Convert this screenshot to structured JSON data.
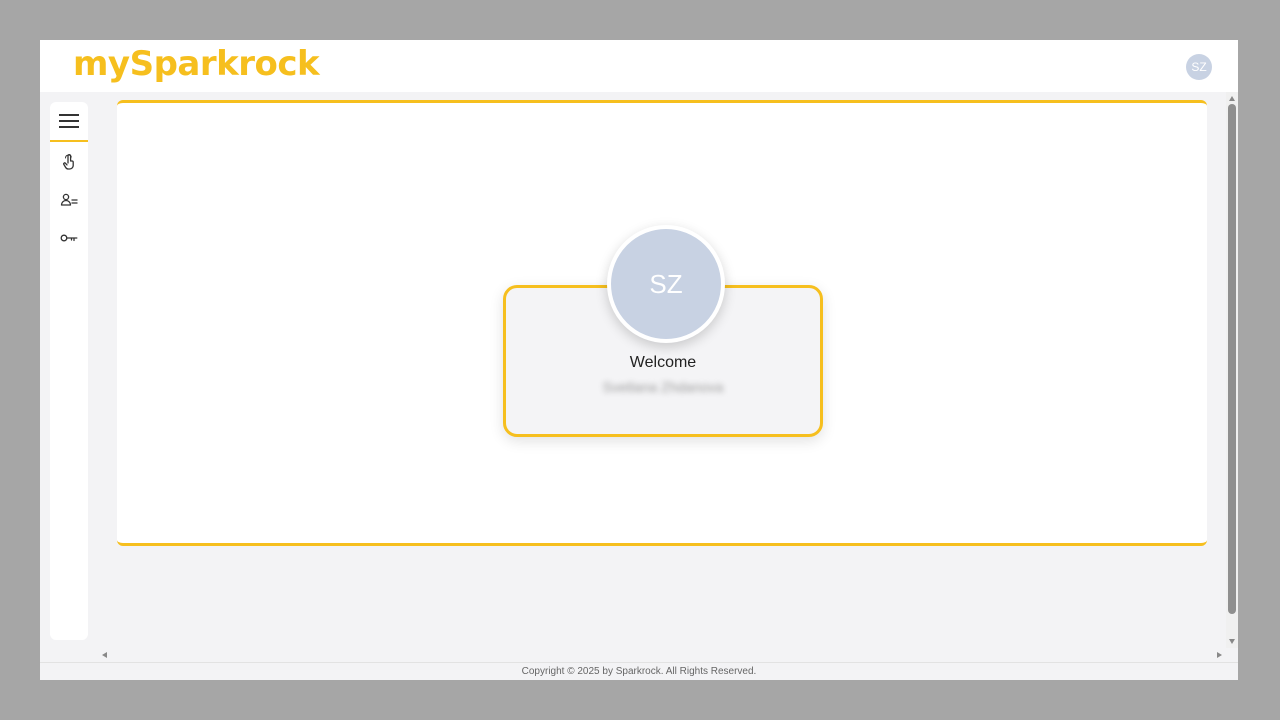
{
  "header": {
    "logo_text": "mySparkrock",
    "user_initials": "SZ"
  },
  "sidebar": {
    "items": [
      {
        "name": "menu",
        "icon": "hamburger-icon"
      },
      {
        "name": "touch",
        "icon": "hand-pointer-icon"
      },
      {
        "name": "users",
        "icon": "user-list-icon"
      },
      {
        "name": "key",
        "icon": "key-icon"
      }
    ]
  },
  "welcome": {
    "initials": "SZ",
    "title": "Welcome",
    "user_name": "Svetlana Zhdanova"
  },
  "footer": {
    "copyright": "Copyright © 2025 by Sparkrock. All Rights Reserved."
  },
  "colors": {
    "accent": "#f6bf1e",
    "avatar_bg": "#c8d2e3",
    "page_bg": "#f3f3f5"
  }
}
